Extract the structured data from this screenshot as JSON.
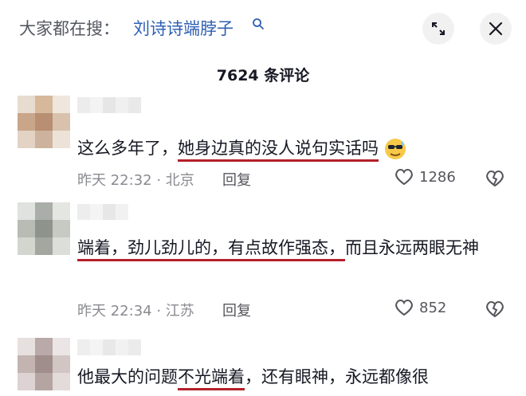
{
  "search": {
    "prefix": "大家都在搜：",
    "term": "刘诗诗端脖子"
  },
  "header": {
    "comment_count": "7624 条评论"
  },
  "comments": [
    {
      "text_plain": "这么多年了，",
      "text_underlined": "她身边真的没人说句实话吗",
      "emoji": "sunglasses-sweat-emoji",
      "time_location": "昨天 22:32 · 北京",
      "reply": "回复",
      "likes": "1286"
    },
    {
      "text_underlined": "端着，劲儿劲儿的，有点故作强态，",
      "text_plain": "而且永远两眼无神",
      "time_location": "昨天 22:34 · 江苏",
      "reply": "回复",
      "likes": "852"
    },
    {
      "text_before": "他最大的问题",
      "text_underlined": "不光端着",
      "text_after": "，还有眼神，永远都像很"
    }
  ],
  "colors": {
    "accent_blue": "#2f5fb3",
    "underline_red": "#b3202a",
    "muted_text": "#8a8b91"
  },
  "icons": {
    "search": "search-icon",
    "collapse": "collapse-icon",
    "close": "close-icon",
    "like": "heart-outline-icon",
    "dislike": "broken-heart-icon"
  }
}
